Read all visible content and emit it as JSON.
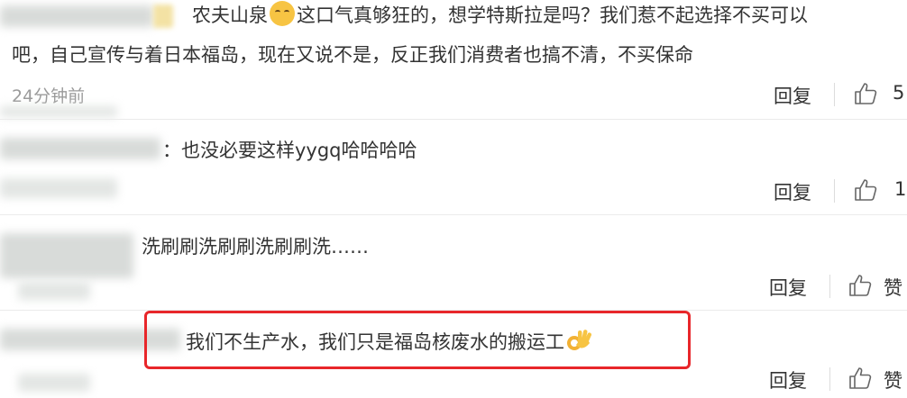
{
  "comments": [
    {
      "text_line1_a": "农夫山泉",
      "text_line1_b": "这口气真够狂的，想学特斯拉是吗？我们惹不起选择不买可以",
      "text_line2": "吧，自己宣传与着日本福岛，现在又说不是，反正我们消费者也搞不清，不买保命",
      "time": "24分钟前",
      "reply_label": "回复",
      "like_count": "5",
      "emoji": "shushing-face"
    },
    {
      "text": "：也没必要这样yygq哈哈哈哈",
      "reply_label": "回复",
      "like_count": "1"
    },
    {
      "text": "洗刷刷洗刷刷洗刷刷洗……",
      "reply_label": "回复",
      "like_label": "赞"
    },
    {
      "text": "我们不生产水，我们只是福岛核废水的搬运工",
      "reply_label": "回复",
      "like_label": "赞",
      "emoji": "ok-hand",
      "highlight_color": "#e8262a"
    }
  ],
  "colors": {
    "text": "#333333",
    "time": "#9a9a9a",
    "divider": "#ebebeb"
  }
}
